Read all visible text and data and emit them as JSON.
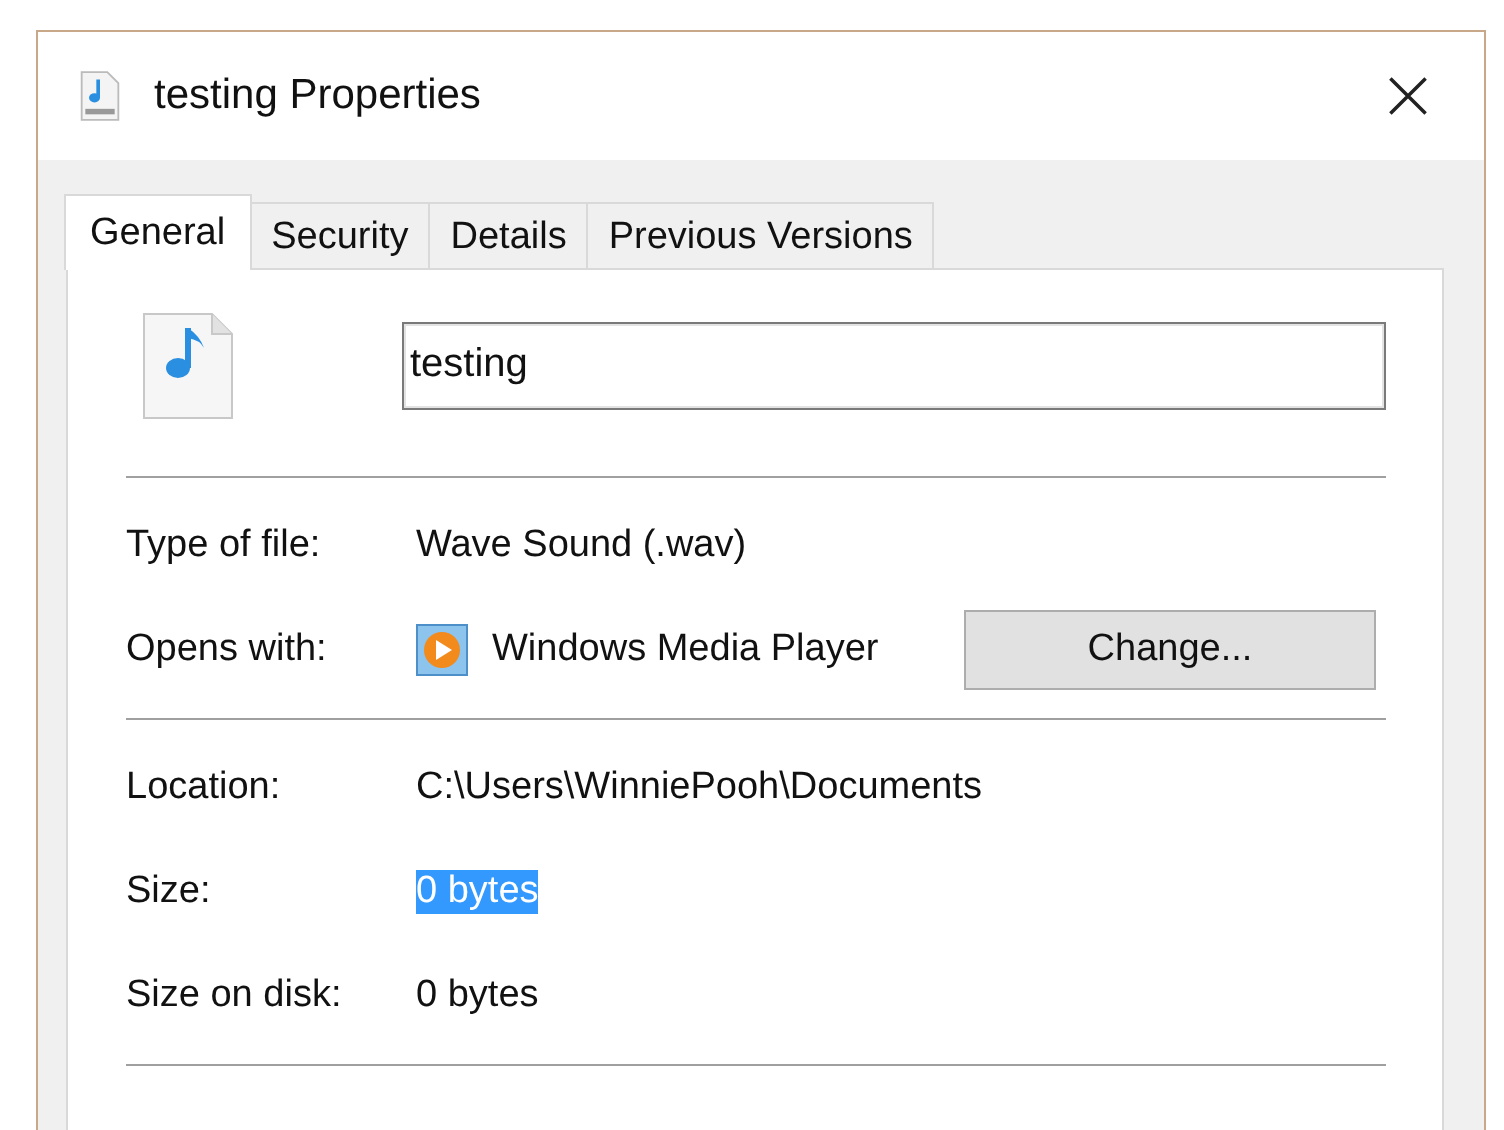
{
  "window": {
    "title": "testing Properties"
  },
  "tabs": [
    {
      "label": "General",
      "selected": true
    },
    {
      "label": "Security",
      "selected": false
    },
    {
      "label": "Details",
      "selected": false
    },
    {
      "label": "Previous Versions",
      "selected": false
    }
  ],
  "file_name": {
    "value": "testing"
  },
  "file_type_rows": [
    {
      "label": "Type of file:",
      "value": "Wave Sound (.wav)"
    },
    {
      "label": "Opens with:",
      "value": "Windows Media Player",
      "kind": "app",
      "button": "Change..."
    }
  ],
  "location_rows": [
    {
      "label": "Location:",
      "value": "C:\\Users\\WinniePooh\\Documents",
      "selected": false
    },
    {
      "label": "Size:",
      "value": "0 bytes",
      "selected": true
    },
    {
      "label": "Size on disk:",
      "value": "0 bytes",
      "selected": false
    }
  ]
}
